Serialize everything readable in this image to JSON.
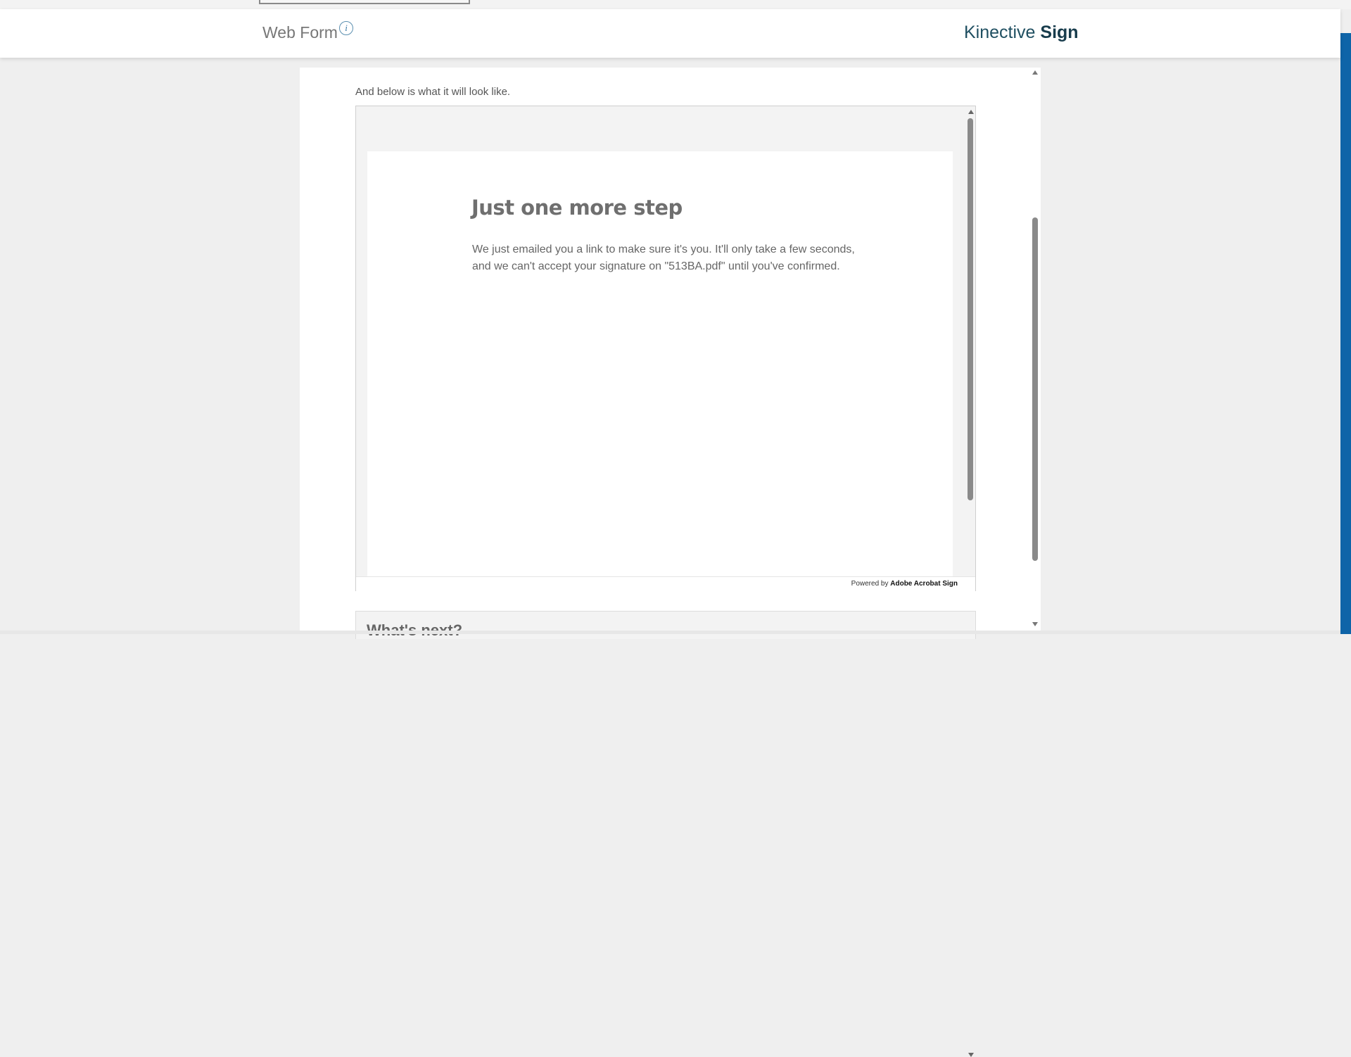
{
  "header": {
    "title": "Web Form",
    "info_icon_glyph": "i",
    "brand_light": "Kinective ",
    "brand_bold": "Sign"
  },
  "content": {
    "intro_text": "And below is what it will look like."
  },
  "preview": {
    "heading": "Just one more step",
    "body": "We just emailed you a link to make sure it's you. It'll only take a few seconds, and we can't accept your signature on \"513BA.pdf\" until you've confirmed.",
    "footer_prefix": "Powered by ",
    "footer_brand": "Adobe Acrobat Sign"
  },
  "next": {
    "title": "What's next?"
  },
  "colors": {
    "brand": "#1f4f61",
    "accent_bar": "#0e64a8",
    "info_icon": "#3a7aa5"
  },
  "icons": [
    "info-icon",
    "scroll-up-arrow-icon",
    "scroll-down-arrow-icon"
  ]
}
